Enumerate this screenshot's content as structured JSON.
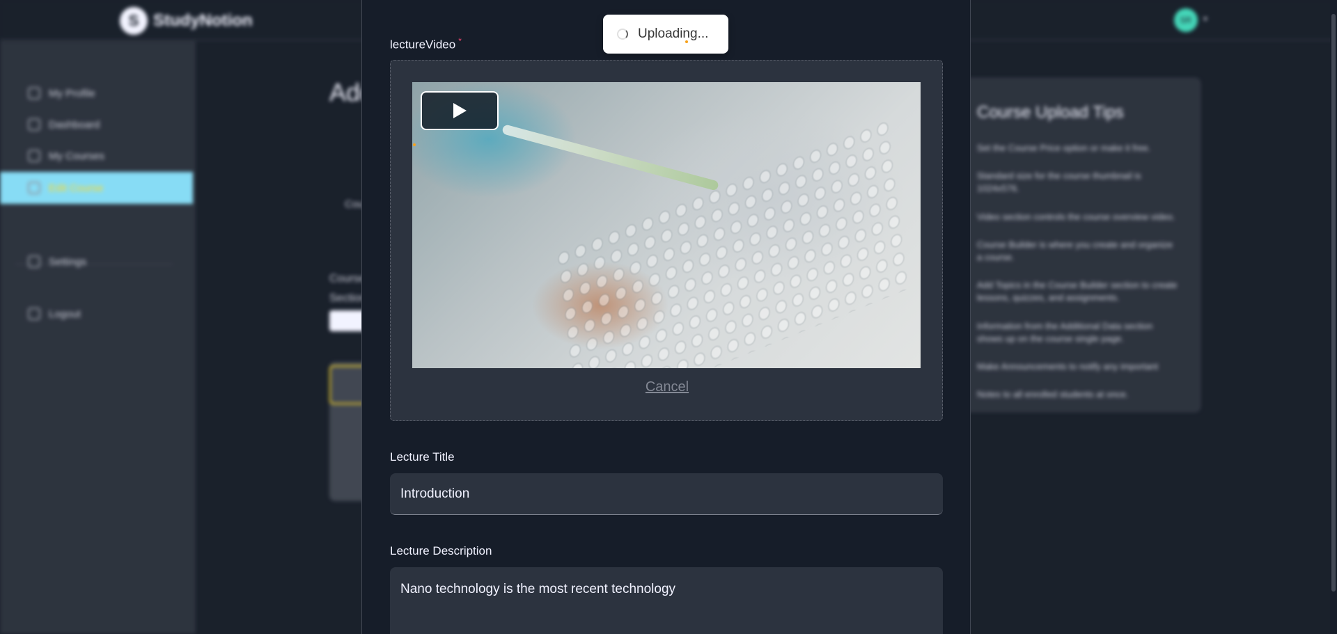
{
  "app": {
    "brand": "StudyNotion",
    "avatar_initials": "SR",
    "avatar_caret": "▾"
  },
  "sidebar": {
    "items": [
      {
        "label": "My Profile"
      },
      {
        "label": "Dashboard"
      },
      {
        "label": "My Courses"
      },
      {
        "label": "Edit Course"
      },
      {
        "label": "Settings"
      },
      {
        "label": "Logout"
      }
    ]
  },
  "main": {
    "title": "Add Course",
    "text_course": "Course Builder",
    "text_section": "Section Name",
    "text_cat": "Course Information"
  },
  "tips": {
    "title": "Course Upload Tips",
    "items": [
      "Set the Course Price option or make it free.",
      "Standard size for the course thumbnail is 1024x576.",
      "Video section controls the course overview video.",
      "Course Builder is where you create and organize a course.",
      "Add Topics in the Course Builder section to create lessons, quizzes, and assignments.",
      "Information from the Additional Data section shows up on the course single page.",
      "Make Announcements to notify any important",
      "Notes to all enrolled students at once."
    ]
  },
  "modal": {
    "video_label": "lectureVideo",
    "required_mark": "*",
    "cancel_label": "Cancel",
    "title_label": "Lecture Title",
    "title_value": "Introduction",
    "desc_label": "Lecture Description",
    "desc_value": "Nano technology is the most recent technology"
  },
  "toast": {
    "text": "Uploading..."
  },
  "colors": {
    "accent": "#FFD60A",
    "active_sidebar": "#7ad8f4",
    "modal_bg": "#161D29",
    "input_bg": "#2C333F"
  }
}
